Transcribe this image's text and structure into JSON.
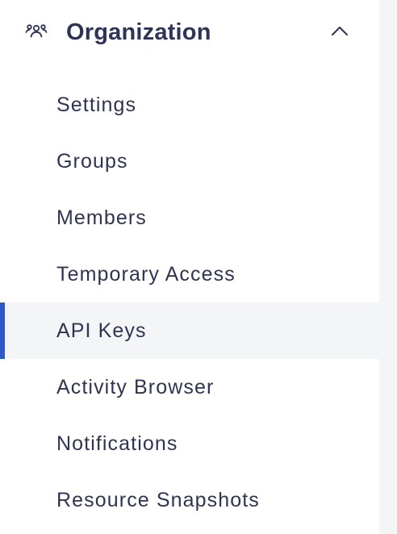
{
  "sidebar": {
    "section": {
      "title": "Organization",
      "icon": "people-group-icon",
      "toggle_icon": "chevron-up-icon",
      "expanded": true
    },
    "items": [
      {
        "label": "Settings",
        "active": false
      },
      {
        "label": "Groups",
        "active": false
      },
      {
        "label": "Members",
        "active": false
      },
      {
        "label": "Temporary Access",
        "active": false
      },
      {
        "label": "API Keys",
        "active": true
      },
      {
        "label": "Activity Browser",
        "active": false
      },
      {
        "label": "Notifications",
        "active": false
      },
      {
        "label": "Resource Snapshots",
        "active": false
      }
    ]
  },
  "colors": {
    "text": "#2f3452",
    "active_indicator": "#2c58c9",
    "active_background": "#f4f5f7"
  }
}
